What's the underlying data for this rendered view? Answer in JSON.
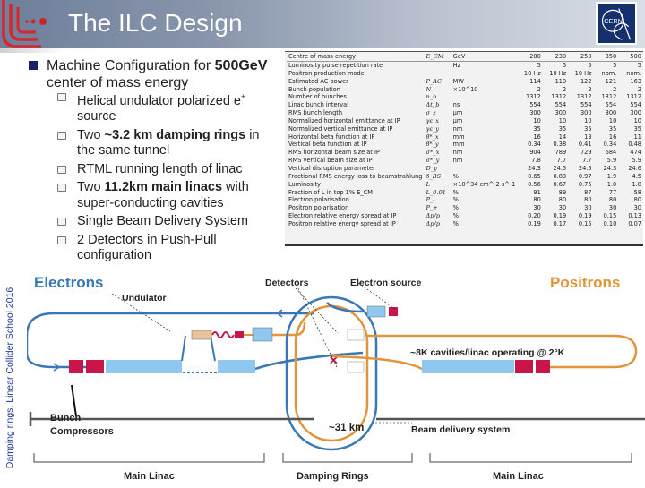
{
  "header": {
    "title": "The ILC Design",
    "logo_left": "ILC logo",
    "logo_right": "CERN",
    "colors": {
      "ilc_red": "#d7262e",
      "cern_blue": "#16306e"
    }
  },
  "side_label": "Damping rings, Linear Collider School 2016",
  "main_bullet": {
    "prefix": "Machine Configuration for ",
    "bold": "500GeV",
    "suffix": " center of mass energy"
  },
  "sub_bullets": [
    {
      "pre": "Helical undulator polarized e",
      "sup": "+",
      "bold": "",
      "post": " source"
    },
    {
      "pre": "Two ",
      "bold": "~3.2 km damping rings",
      "post": " in the same tunnel"
    },
    {
      "pre": "RTML running length of linac",
      "bold": "",
      "post": ""
    },
    {
      "pre": "Two ",
      "bold": "11.2km main linacs",
      "post": " with super-conducting cavities"
    },
    {
      "pre": "Single Beam Delivery System",
      "bold": "",
      "post": ""
    },
    {
      "pre": "2 Detectors in Push-Pull configuration",
      "bold": "",
      "post": ""
    }
  ],
  "param_table": {
    "header": [
      "Centre of mass energy",
      "E_CM",
      "GeV",
      "200",
      "230",
      "250",
      "350",
      "500"
    ],
    "rows": [
      [
        "Luminosity pulse repetition rate",
        "",
        "Hz",
        "5",
        "5",
        "5",
        "5",
        "5"
      ],
      [
        "Positron production mode",
        "",
        "",
        "10 Hz",
        "10 Hz",
        "10 Hz",
        "nom.",
        "nom."
      ],
      [
        "Estimated AC power",
        "P_AC",
        "MW",
        "114",
        "119",
        "122",
        "121",
        "163"
      ],
      [
        "Bunch population",
        "N",
        "×10^10",
        "2",
        "2",
        "2",
        "2",
        "2"
      ],
      [
        "Number of bunches",
        "n_b",
        "",
        "1312",
        "1312",
        "1312",
        "1312",
        "1312"
      ],
      [
        "Linac bunch interval",
        "Δt_b",
        "ns",
        "554",
        "554",
        "554",
        "554",
        "554"
      ],
      [
        "RMS bunch length",
        "σ_z",
        "μm",
        "300",
        "300",
        "300",
        "300",
        "300"
      ],
      [
        "Normalized horizontal emittance at IP",
        "γε_x",
        "μm",
        "10",
        "10",
        "10",
        "10",
        "10"
      ],
      [
        "Normalized vertical emittance at IP",
        "γε_y",
        "nm",
        "35",
        "35",
        "35",
        "35",
        "35"
      ],
      [
        "Horizontal beta function at IP",
        "β*_x",
        "mm",
        "16",
        "14",
        "13",
        "16",
        "11"
      ],
      [
        "Vertical beta function at IP",
        "β*_y",
        "mm",
        "0.34",
        "0.38",
        "0.41",
        "0.34",
        "0.48"
      ],
      [
        "RMS horizontal beam size at IP",
        "σ*_x",
        "nm",
        "904",
        "789",
        "729",
        "684",
        "474"
      ],
      [
        "RMS vertical beam size at IP",
        "σ*_y",
        "nm",
        "7.8",
        "7.7",
        "7.7",
        "5.9",
        "5.9"
      ],
      [
        "Vertical disruption parameter",
        "D_y",
        "",
        "24.3",
        "24.5",
        "24.5",
        "24.3",
        "24.6"
      ],
      [
        "Fractional RMS energy loss to beamstrahlung",
        "δ_BS",
        "%",
        "0.65",
        "0.83",
        "0.97",
        "1.9",
        "4.5"
      ],
      [
        "Luminosity",
        "L",
        "×10^34 cm^-2 s^-1",
        "0.56",
        "0.67",
        "0.75",
        "1.0",
        "1.8"
      ],
      [
        "Fraction of L in top 1% E_CM",
        "L_0.01",
        "%",
        "91",
        "89",
        "87",
        "77",
        "58"
      ],
      [
        "Electron polarisation",
        "P_-",
        "%",
        "80",
        "80",
        "80",
        "80",
        "80"
      ],
      [
        "Positron polarisation",
        "P_+",
        "%",
        "30",
        "30",
        "30",
        "30",
        "30"
      ],
      [
        "Electron relative energy spread at IP",
        "Δp/p",
        "%",
        "0.20",
        "0.19",
        "0.19",
        "0.15",
        "0.13"
      ],
      [
        "Positron relative energy spread at IP",
        "Δp/p",
        "%",
        "0.19",
        "0.17",
        "0.15",
        "0.10",
        "0.07"
      ]
    ]
  },
  "diagram": {
    "electrons": "Electrons",
    "positrons": "Positrons",
    "detectors": "Detectors",
    "electron_source": "Electron source",
    "undulator": "Undulator",
    "cavities_note": "~8K cavities/linac operating @ 2°K",
    "bunch_compressors_1": "Bunch",
    "bunch_compressors_2": "Compressors",
    "length": "~31 km",
    "bds": "Beam delivery system",
    "main_linac_left": "Main Linac",
    "damping_rings": "Damping Rings",
    "main_linac_right": "Main Linac",
    "colors": {
      "electron": "#3a78b5",
      "positron": "#e0953a",
      "cavity": "#8ec8ef",
      "compressor": "#c8164a"
    }
  }
}
